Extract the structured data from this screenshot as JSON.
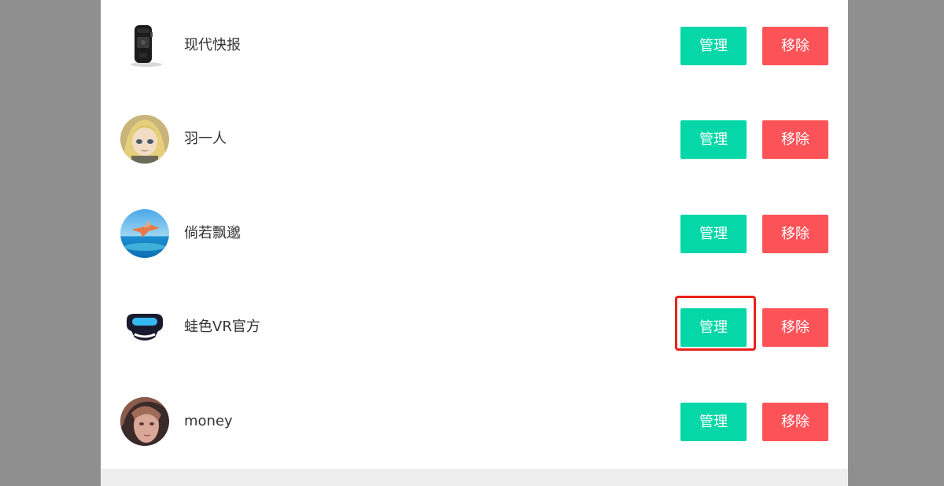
{
  "accounts": [
    {
      "name": "现代快报",
      "avatar": "device-logo-icon",
      "manage_label": "管理",
      "remove_label": "移除",
      "highlighted": false
    },
    {
      "name": "羽一人",
      "avatar": "anime-girl-avatar",
      "manage_label": "管理",
      "remove_label": "移除",
      "highlighted": false
    },
    {
      "name": "倘若飘邈",
      "avatar": "sky-plane-avatar",
      "manage_label": "管理",
      "remove_label": "移除",
      "highlighted": false
    },
    {
      "name": "蛙色VR官方",
      "avatar": "vr-headset-logo-icon",
      "manage_label": "管理",
      "remove_label": "移除",
      "highlighted": true
    },
    {
      "name": "money",
      "avatar": "portrait-avatar",
      "manage_label": "管理",
      "remove_label": "移除",
      "highlighted": false
    }
  ],
  "colors": {
    "manage_button": "#05d7a8",
    "remove_button": "#fc5359",
    "highlight": "#e8231b",
    "backdrop": "#8f8f8f"
  }
}
